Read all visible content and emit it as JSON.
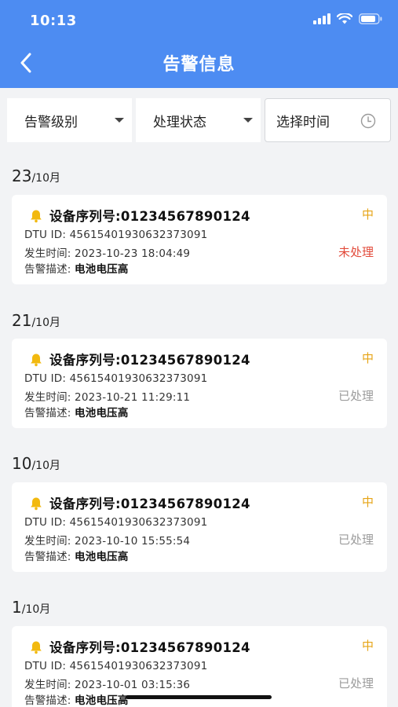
{
  "status_bar": {
    "time": "10:13"
  },
  "header": {
    "title": "告警信息"
  },
  "filters": {
    "level_label": "告警级别",
    "status_label": "处理状态",
    "time_label": "选择时间"
  },
  "groups": [
    {
      "day": "23",
      "month": "/10月",
      "card": {
        "serial": "设备序列号:01234567890124",
        "dtu": "DTU ID: 4561540193063237309​1",
        "time": "发生时间: 2023-10-23 18:04:49",
        "desc_label": "告警描述: ",
        "desc": "电池电压高",
        "level": "中",
        "status": "未处理"
      }
    },
    {
      "day": "21",
      "month": "/10月",
      "card": {
        "serial": "设备序列号:01234567890124",
        "dtu": "DTU ID: 45615401930632373091",
        "time": "发生时间: 2023-10-21 11:29:11",
        "desc_label": "告警描述: ",
        "desc": "电池电压高",
        "level": "中",
        "status": "已处理"
      }
    },
    {
      "day": "10",
      "month": "/10月",
      "card": {
        "serial": "设备序列号:01234567890124",
        "dtu": "DTU ID: 45615401930632373091",
        "time": "发生时间: 2023-10-10 15:55:54",
        "desc_label": "告警描述: ",
        "desc": "电池电压高",
        "level": "中",
        "status": "已处理"
      }
    },
    {
      "day": "1",
      "month": "/10月",
      "card": {
        "serial": "设备序列号:01234567890124",
        "dtu": "DTU ID: 45615401930632373091",
        "time": "发生时间: 2023-10-01 03:15:36",
        "desc_label": "告警描述: ",
        "desc": "电池电压高",
        "level": "中",
        "status": "已处理"
      }
    }
  ],
  "colors": {
    "header_bg": "#4d8cf2",
    "level_medium": "#e6a416",
    "status_pending": "#e24b3b",
    "status_done": "#9b9b9b"
  },
  "icons": [
    "back-arrow-icon",
    "caret-down-icon",
    "clock-icon",
    "bell-icon",
    "signal-icon",
    "wifi-icon",
    "battery-icon"
  ]
}
